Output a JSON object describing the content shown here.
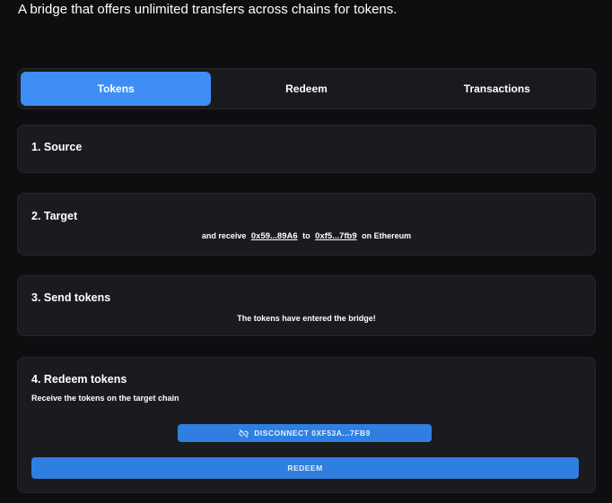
{
  "header": {
    "tagline": "A bridge that offers unlimited transfers across chains for tokens."
  },
  "tabs": [
    {
      "label": "Tokens",
      "active": true
    },
    {
      "label": "Redeem",
      "active": false
    },
    {
      "label": "Transactions",
      "active": false
    }
  ],
  "steps": {
    "source": {
      "title": "1. Source"
    },
    "target": {
      "title": "2. Target",
      "prefix": "and receive",
      "token_address": "0x59...89A6",
      "connector": "to",
      "recipient_address": "0xf5...7fb9",
      "suffix": "on Ethereum"
    },
    "send": {
      "title": "3. Send tokens",
      "status": "The tokens have entered the bridge!"
    },
    "redeem": {
      "title": "4. Redeem tokens",
      "subtitle": "Receive the tokens on the target chain",
      "disconnect_label": "DISCONNECT 0XF53A...7FB9",
      "disconnect_icon": "unlink-icon",
      "redeem_label": "REDEEM"
    }
  },
  "colors": {
    "background": "#0e0e11",
    "card": "#1b1b1f",
    "accent_tab": "#3e8ef5",
    "accent_button": "#2f7fe0"
  }
}
